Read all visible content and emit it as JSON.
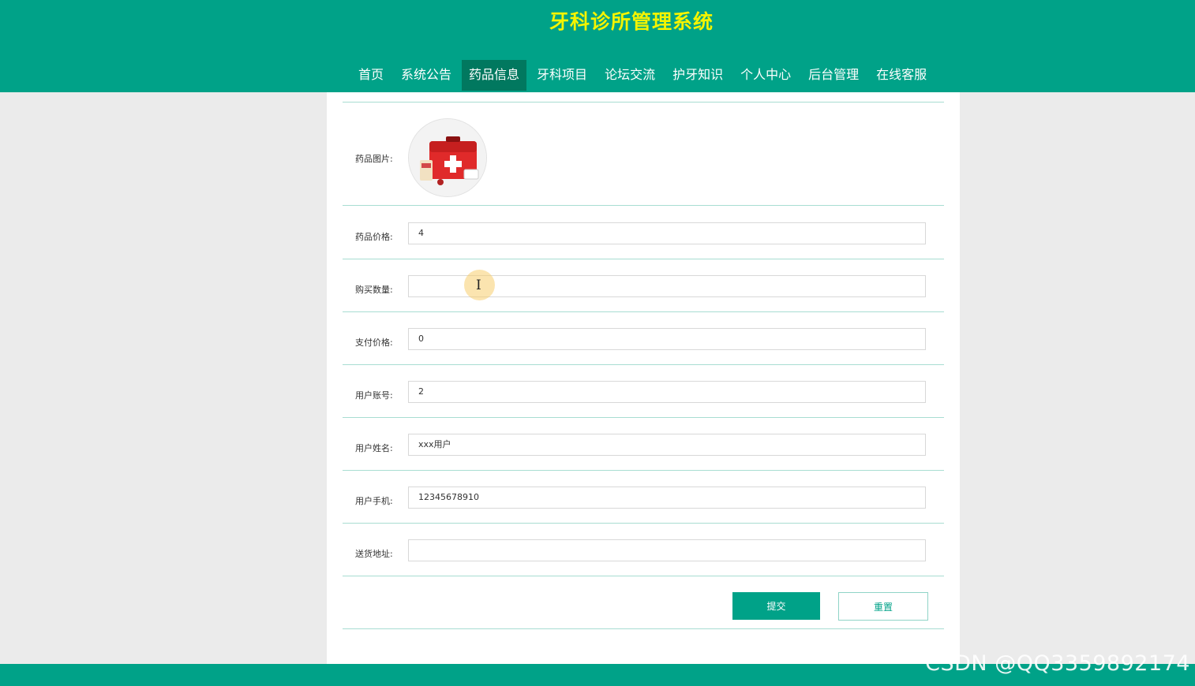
{
  "site": {
    "title": "牙科诊所管理系统"
  },
  "nav": {
    "items": [
      {
        "label": "首页"
      },
      {
        "label": "系统公告"
      },
      {
        "label": "药品信息",
        "active": true
      },
      {
        "label": "牙科项目"
      },
      {
        "label": "论坛交流"
      },
      {
        "label": "护牙知识"
      },
      {
        "label": "个人中心"
      },
      {
        "label": "后台管理"
      },
      {
        "label": "在线客服"
      }
    ]
  },
  "form": {
    "image_label": "药品图片:",
    "image_icon": "first-aid-kit",
    "fields": [
      {
        "label": "药品价格:",
        "value": "4"
      },
      {
        "label": "购买数量:",
        "value": ""
      },
      {
        "label": "支付价格:",
        "value": "0"
      },
      {
        "label": "用户账号:",
        "value": "2"
      },
      {
        "label": "用户姓名:",
        "value": "xxx用户"
      },
      {
        "label": "用户手机:",
        "value": "12345678910"
      },
      {
        "label": "送货地址:",
        "value": ""
      }
    ],
    "submit_label": "提交",
    "reset_label": "重置"
  },
  "colors": {
    "brand": "#00a288",
    "brand_dark": "#01785f",
    "title": "#f4f400"
  },
  "watermark": "CSDN @QQ3359892174"
}
